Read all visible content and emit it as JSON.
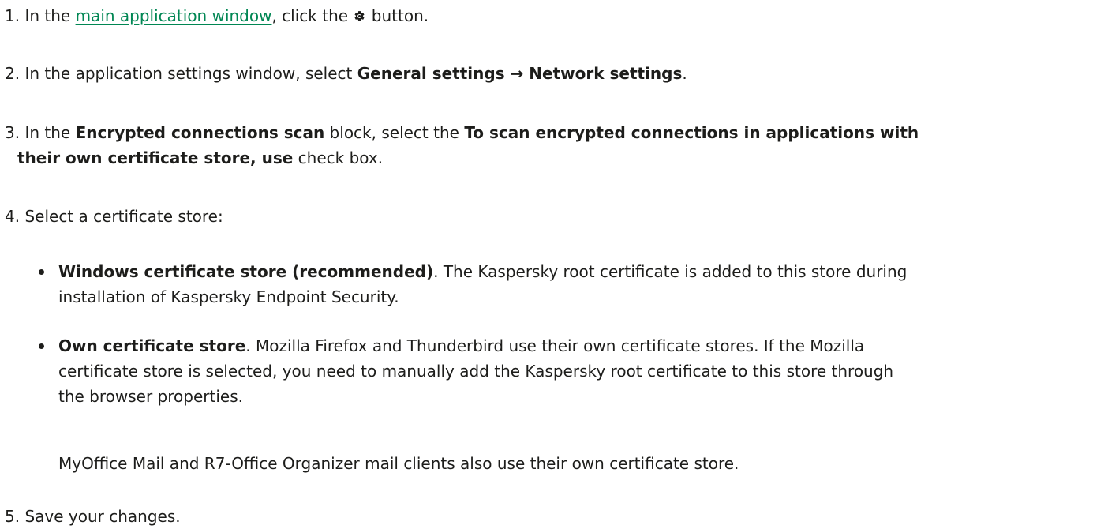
{
  "steps": [
    {
      "number": "1.",
      "parts": {
        "a": "In the ",
        "link": "main application window",
        "b": ", click the ",
        "icon": "gear-icon",
        "c": " button."
      }
    },
    {
      "number": "2.",
      "parts": {
        "a": "In the application settings window, select ",
        "bold": "General settings → Network settings",
        "b": "."
      }
    },
    {
      "number": "3.",
      "parts": {
        "a": "In the ",
        "bold1": "Encrypted connections scan",
        "b": " block, select the ",
        "bold2a": "To scan encrypted connections in applications with",
        "bold2b": "their own certificate store, use",
        "c": " check box."
      }
    },
    {
      "number": "4.",
      "parts": {
        "a": "Select a certificate store:"
      },
      "bullets": [
        {
          "bold": "Windows certificate store (recommended)",
          "line1": ". The Kaspersky root certificate is added to this store during",
          "line2": "installation of Kaspersky Endpoint Security."
        },
        {
          "bold": "Own certificate store",
          "line1": ". Mozilla Firefox and Thunderbird use their own certificate stores. If the Mozilla",
          "line2": "certificate store is selected, you need to manually add the Kaspersky root certificate to this store through",
          "line3": "the browser properties."
        }
      ],
      "note": "MyOffice Mail and R7-Office Organizer mail clients also use their own certificate store."
    },
    {
      "number": "5.",
      "parts": {
        "a": "Save your changes."
      }
    }
  ],
  "colors": {
    "text": "#1d1d1b",
    "link": "#008653"
  }
}
